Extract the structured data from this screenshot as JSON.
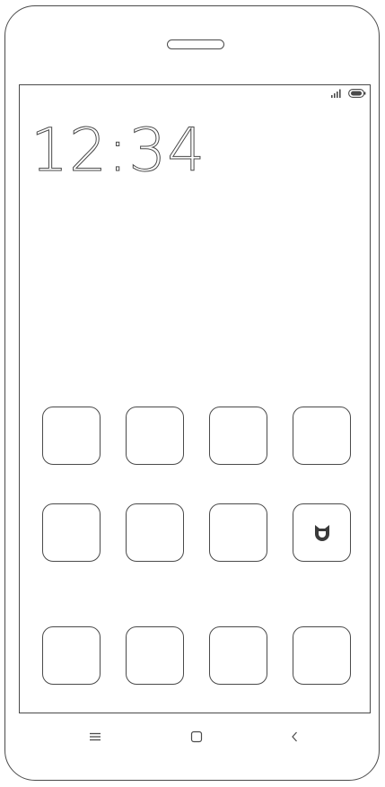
{
  "status_bar": {
    "icons": [
      "signal-icon",
      "battery-icon"
    ]
  },
  "lockscreen": {
    "time": "12:34"
  },
  "home": {
    "rows": [
      [
        "blank-app",
        "blank-app",
        "blank-app",
        "blank-app"
      ],
      [
        "blank-app",
        "blank-app",
        "blank-app",
        "mijia-app"
      ],
      [
        "blank-app",
        "blank-app",
        "blank-app",
        "blank-app"
      ]
    ]
  },
  "nav_bar": {
    "icons": [
      "menu-icon",
      "home-icon",
      "back-icon"
    ]
  },
  "colors": {
    "outline": "#4a4a4a",
    "background": "#ffffff"
  }
}
